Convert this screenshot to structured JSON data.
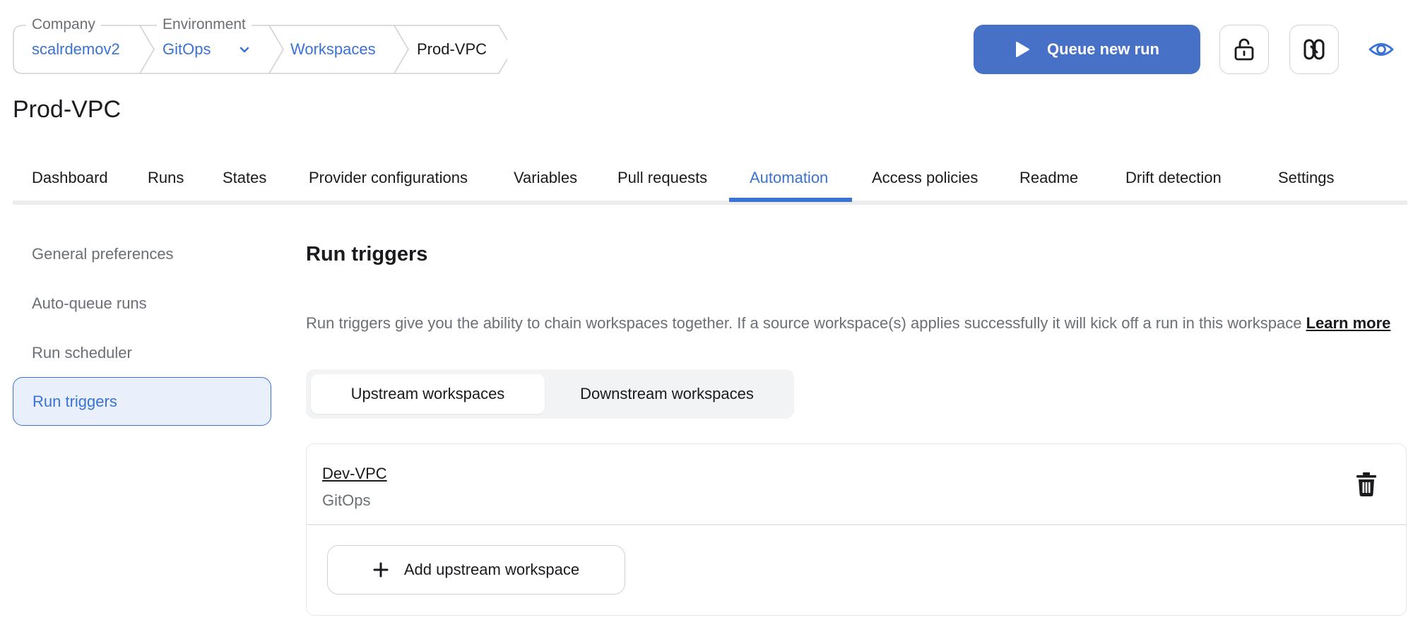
{
  "breadcrumb": {
    "company_caption": "Company",
    "company_value": "scalrdemov2",
    "environment_caption": "Environment",
    "environment_value": "GitOps",
    "workspaces": "Workspaces",
    "current": "Prod-VPC"
  },
  "header": {
    "queue_label": "Queue new run",
    "lock_icon": "unlock-icon",
    "link_icon": "link-icon",
    "watch_icon": "eye-icon"
  },
  "page_title": "Prod-VPC",
  "tabs": [
    {
      "label": "Dashboard"
    },
    {
      "label": "Runs"
    },
    {
      "label": "States"
    },
    {
      "label": "Provider configurations"
    },
    {
      "label": "Variables"
    },
    {
      "label": "Pull requests"
    },
    {
      "label": "Automation",
      "active": true
    },
    {
      "label": "Access policies"
    },
    {
      "label": "Readme"
    },
    {
      "label": "Drift detection"
    },
    {
      "label": "Settings"
    }
  ],
  "sidebar": {
    "items": [
      {
        "label": "General preferences"
      },
      {
        "label": "Auto-queue runs"
      },
      {
        "label": "Run scheduler"
      },
      {
        "label": "Run triggers",
        "active": true
      }
    ]
  },
  "main": {
    "title": "Run triggers",
    "description": "Run triggers give you the ability to chain workspaces together. If a source workspace(s) applies successfully it will kick off a run in this workspace",
    "learn_more": "Learn more",
    "segments": {
      "upstream": "Upstream workspaces",
      "downstream": "Downstream workspaces",
      "selected": "upstream"
    },
    "workspaces": [
      {
        "name": "Dev-VPC",
        "environment": "GitOps"
      }
    ],
    "add_label": "Add upstream workspace"
  },
  "colors": {
    "accent": "#3a73d4",
    "primary_button": "#4770c7",
    "muted_text": "#6b6f76"
  }
}
